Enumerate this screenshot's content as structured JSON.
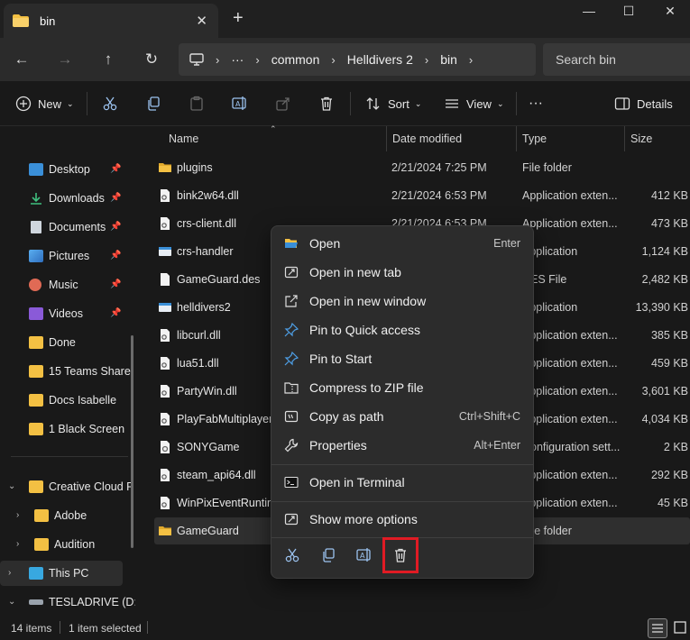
{
  "window": {
    "tab_title": "bin",
    "tab_close": "✕",
    "new_tab": "+",
    "minimize": "—",
    "maximize": "☐",
    "close": "✕"
  },
  "address": {
    "ellipsis": "···",
    "crumbs": [
      "common",
      "Helldivers 2",
      "bin"
    ],
    "search_placeholder": "Search bin"
  },
  "toolbar": {
    "new_label": "New",
    "sort_label": "Sort",
    "view_label": "View",
    "more_label": "···",
    "details_label": "Details"
  },
  "sidebar": {
    "pinned": [
      {
        "label": "Desktop",
        "icon": "desktop-icon"
      },
      {
        "label": "Downloads",
        "icon": "download-icon"
      },
      {
        "label": "Documents",
        "icon": "document-icon"
      },
      {
        "label": "Pictures",
        "icon": "picture-icon"
      },
      {
        "label": "Music",
        "icon": "music-icon"
      },
      {
        "label": "Videos",
        "icon": "video-icon"
      }
    ],
    "folders": [
      "Done",
      "15 Teams Share",
      "Docs Isabelle",
      "1 Black Screen"
    ],
    "tree": [
      {
        "label": "Creative Cloud F",
        "expanded": true
      },
      {
        "label": "Adobe"
      },
      {
        "label": "Audition"
      },
      {
        "label": "This PC"
      },
      {
        "label": "TESLADRIVE (D:)"
      }
    ]
  },
  "columns": {
    "name": "Name",
    "date": "Date modified",
    "type": "Type",
    "size": "Size"
  },
  "files": [
    {
      "name": "plugins",
      "date": "2/21/2024 7:25 PM",
      "type": "File folder",
      "size": "",
      "icon": "folder-icon"
    },
    {
      "name": "bink2w64.dll",
      "date": "2/21/2024 6:53 PM",
      "type": "Application exten...",
      "size": "412 KB",
      "icon": "dll-file-icon"
    },
    {
      "name": "crs-client.dll",
      "date": "2/21/2024 6:53 PM",
      "type": "Application exten...",
      "size": "473 KB",
      "icon": "dll-file-icon"
    },
    {
      "name": "crs-handler",
      "date": "",
      "type": "Application",
      "size": "1,124 KB",
      "icon": "app-icon"
    },
    {
      "name": "GameGuard.des",
      "date": "",
      "type": "DES File",
      "size": "2,482 KB",
      "icon": "file-icon"
    },
    {
      "name": "helldivers2",
      "date": "",
      "type": "Application",
      "size": "13,390 KB",
      "icon": "app-icon"
    },
    {
      "name": "libcurl.dll",
      "date": "",
      "type": "Application exten...",
      "size": "385 KB",
      "icon": "dll-file-icon"
    },
    {
      "name": "lua51.dll",
      "date": "",
      "type": "Application exten...",
      "size": "459 KB",
      "icon": "dll-file-icon"
    },
    {
      "name": "PartyWin.dll",
      "date": "",
      "type": "Application exten...",
      "size": "3,601 KB",
      "icon": "dll-file-icon"
    },
    {
      "name": "PlayFabMultiplayerW",
      "date": "",
      "type": "Application exten...",
      "size": "4,034 KB",
      "icon": "dll-file-icon"
    },
    {
      "name": "SONYGame",
      "date": "",
      "type": "Configuration sett...",
      "size": "2 KB",
      "icon": "config-file-icon"
    },
    {
      "name": "steam_api64.dll",
      "date": "",
      "type": "Application exten...",
      "size": "292 KB",
      "icon": "dll-file-icon"
    },
    {
      "name": "WinPixEventRuntim",
      "date": "",
      "type": "Application exten...",
      "size": "45 KB",
      "icon": "dll-file-icon"
    },
    {
      "name": "GameGuard",
      "date": "",
      "type": "File folder",
      "size": "",
      "icon": "folder-icon",
      "selected": true
    }
  ],
  "context_menu": {
    "items": [
      {
        "label": "Open",
        "shortcut": "Enter"
      },
      {
        "label": "Open in new tab",
        "shortcut": ""
      },
      {
        "label": "Open in new window",
        "shortcut": ""
      },
      {
        "label": "Pin to Quick access",
        "shortcut": ""
      },
      {
        "label": "Pin to Start",
        "shortcut": ""
      },
      {
        "label": "Compress to ZIP file",
        "shortcut": ""
      },
      {
        "label": "Copy as path",
        "shortcut": "Ctrl+Shift+C"
      },
      {
        "label": "Properties",
        "shortcut": "Alt+Enter"
      },
      {
        "label": "Open in Terminal",
        "shortcut": ""
      },
      {
        "label": "Show more options",
        "shortcut": ""
      }
    ],
    "quick_actions": [
      "cut",
      "copy",
      "rename",
      "delete"
    ],
    "highlighted_action": "delete"
  },
  "status": {
    "item_count": "14 items",
    "selection": "1 item selected"
  },
  "colors": {
    "accent_folder": "#f3c043",
    "highlight_box": "#e01b24",
    "pin_blue": "#4ea0e8"
  }
}
